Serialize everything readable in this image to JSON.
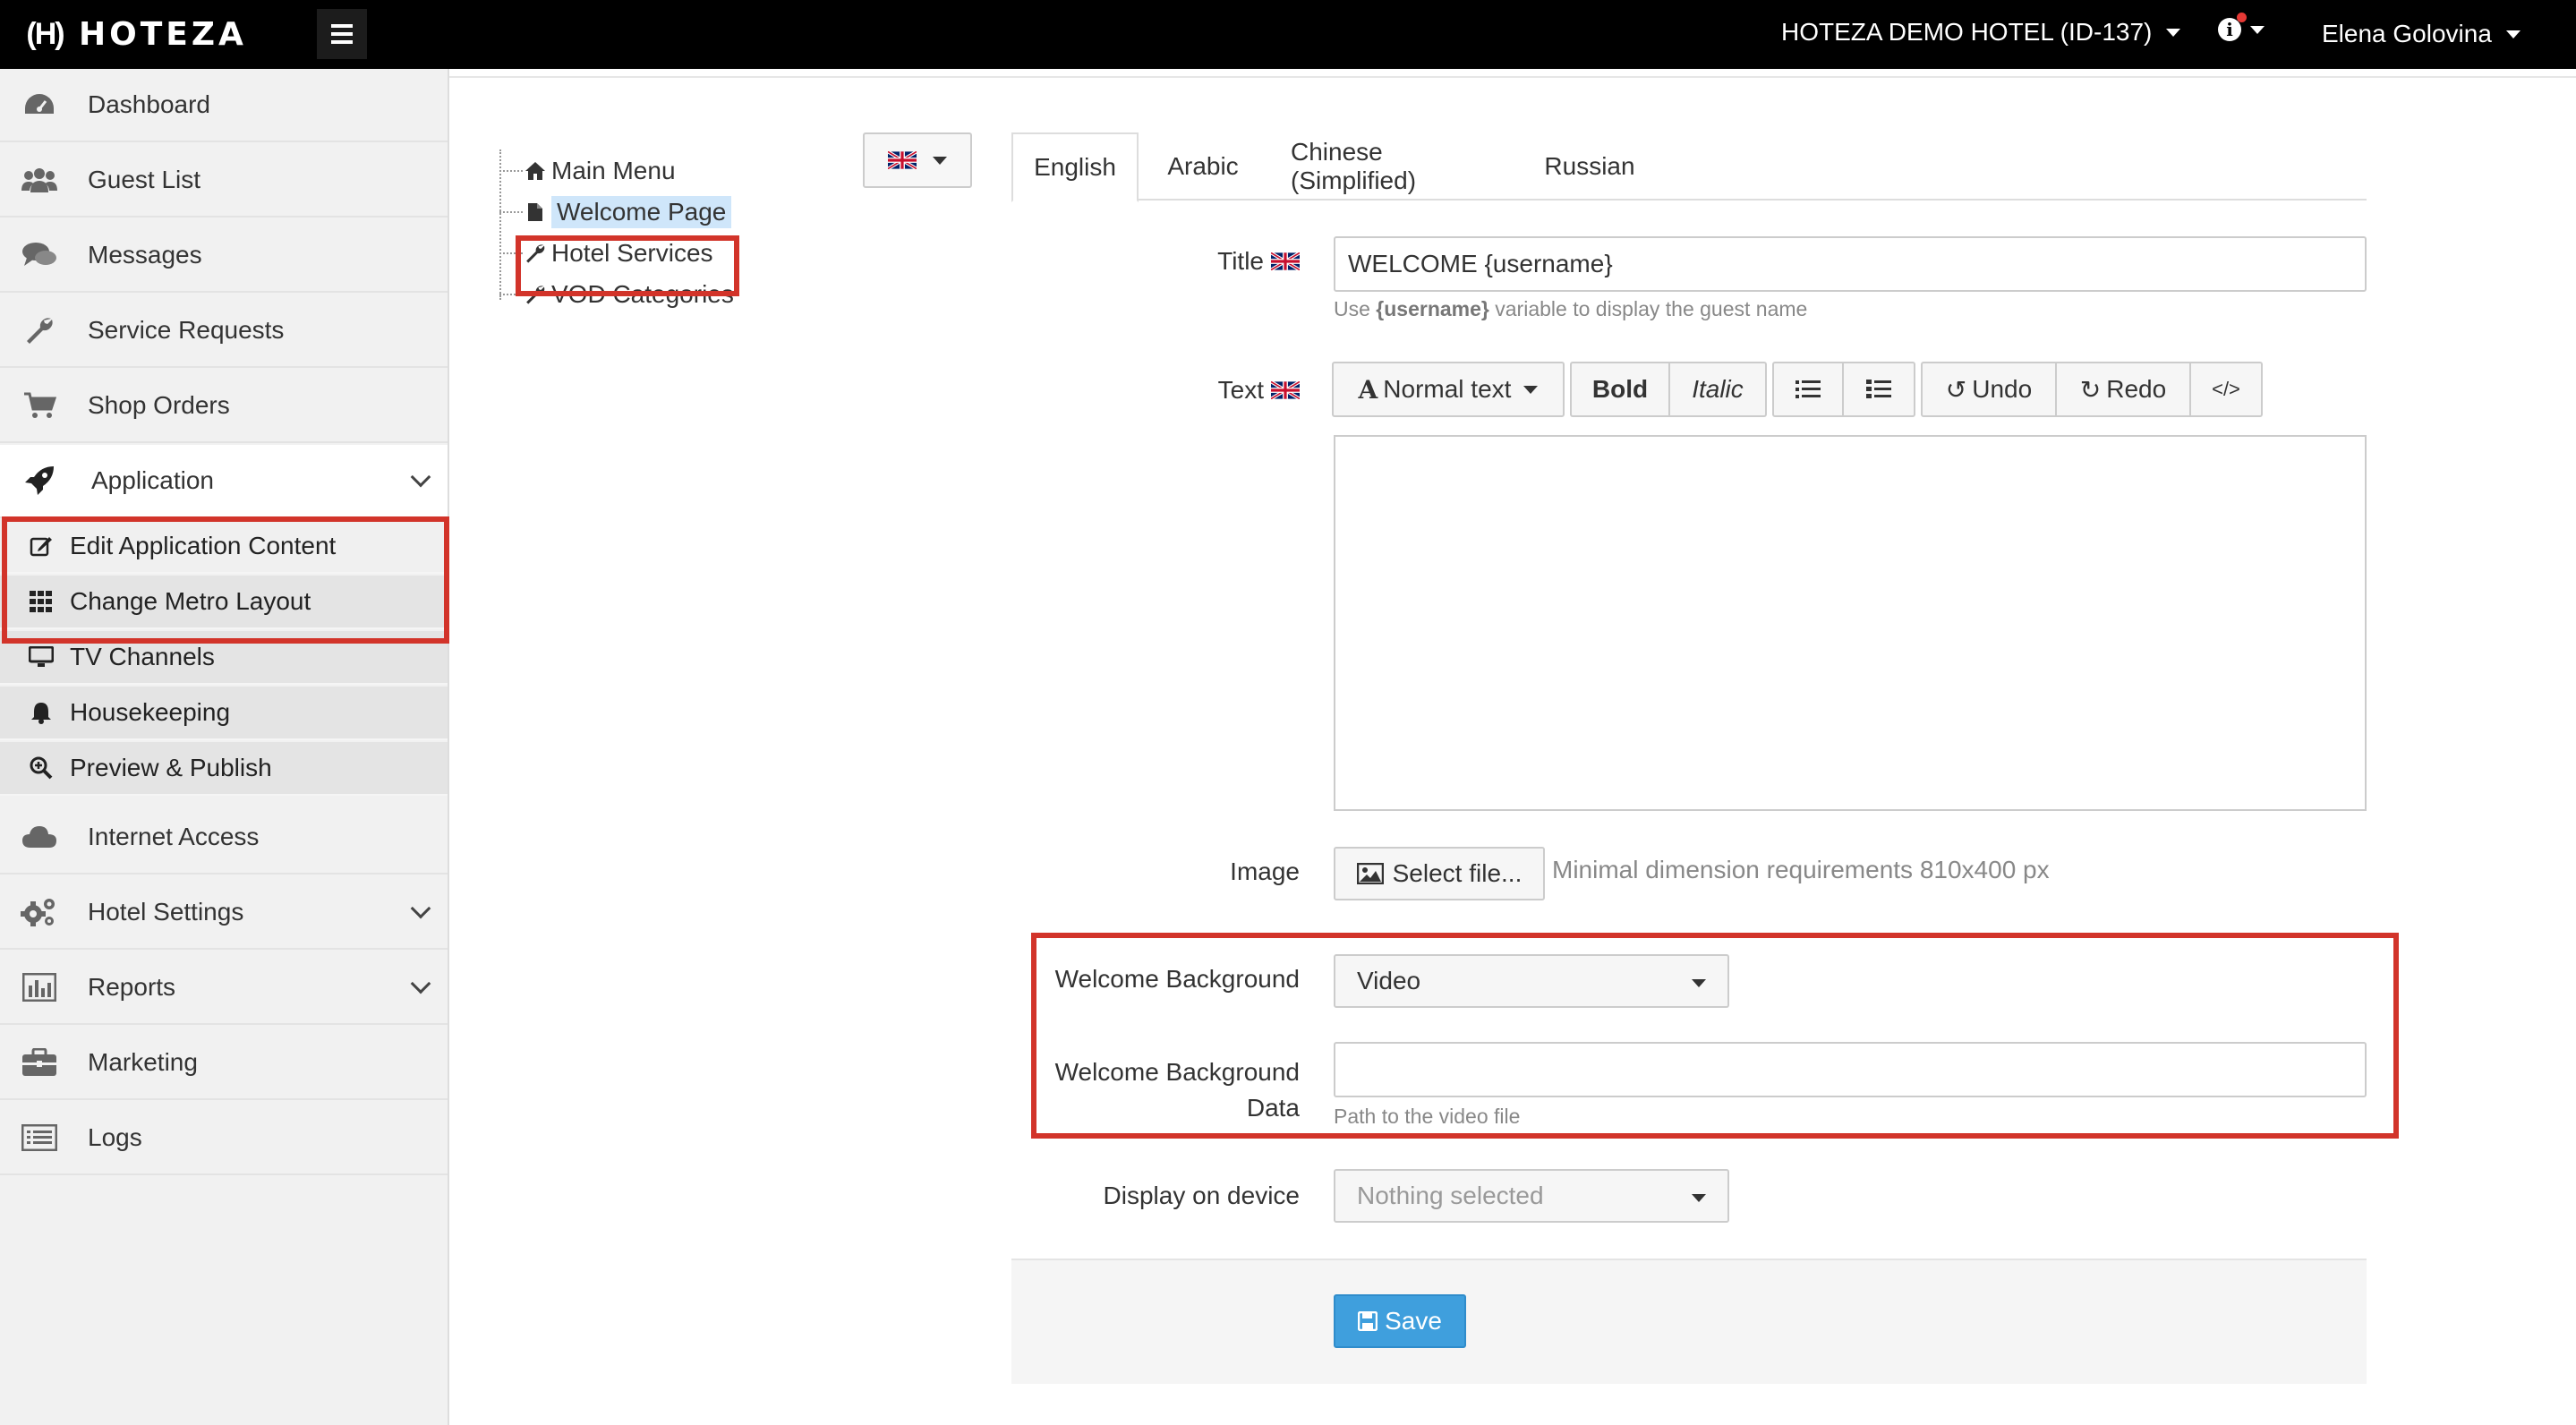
{
  "topbar": {
    "logo_text": "HOTEZA",
    "hotel_name": "HOTEZA DEMO HOTEL (ID-137)",
    "user_name": "Elena Golovina"
  },
  "sidebar": {
    "items": [
      {
        "label": "Dashboard",
        "icon": "dashboard-icon"
      },
      {
        "label": "Guest List",
        "icon": "users-icon"
      },
      {
        "label": "Messages",
        "icon": "comments-icon"
      },
      {
        "label": "Service Requests",
        "icon": "wrench-icon"
      },
      {
        "label": "Shop Orders",
        "icon": "cart-icon"
      },
      {
        "label": "Application",
        "icon": "rocket-icon"
      },
      {
        "label": "Internet Access",
        "icon": "cloud-icon"
      },
      {
        "label": "Hotel Settings",
        "icon": "gears-icon"
      },
      {
        "label": "Reports",
        "icon": "bar-chart-icon"
      },
      {
        "label": "Marketing",
        "icon": "briefcase-icon"
      },
      {
        "label": "Logs",
        "icon": "list-icon"
      }
    ],
    "sub_items": [
      {
        "label": "Edit Application Content",
        "icon": "edit-icon"
      },
      {
        "label": "Change Metro Layout",
        "icon": "grid-icon"
      },
      {
        "label": "TV Channels",
        "icon": "monitor-icon"
      },
      {
        "label": "Housekeeping",
        "icon": "bell-icon"
      },
      {
        "label": "Preview & Publish",
        "icon": "search-plus-icon"
      }
    ]
  },
  "tree": {
    "items": [
      {
        "label": "Main Menu",
        "icon": "home-icon"
      },
      {
        "label": "Welcome Page",
        "icon": "file-icon",
        "selected": true
      },
      {
        "label": "Hotel Services",
        "icon": "wrench-icon"
      },
      {
        "label": "VOD Categories",
        "icon": "wrench-icon"
      }
    ]
  },
  "tabs": [
    "English",
    "Arabic",
    "Chinese (Simplified)",
    "Russian"
  ],
  "active_tab": "English",
  "form": {
    "title_label": "Title",
    "title_value": "WELCOME {username}",
    "title_help_prefix": "Use ",
    "title_help_var": "{username}",
    "title_help_suffix": " variable to display the guest name",
    "text_label": "Text",
    "toolbar": {
      "normal_text": "Normal text",
      "bold": "Bold",
      "italic": "Italic",
      "undo": "Undo",
      "redo": "Redo",
      "code": "</>"
    },
    "image_label": "Image",
    "select_file": "Select file...",
    "image_help": "Minimal dimension requirements 810x400 px",
    "bg_label": "Welcome Background",
    "bg_value": "Video",
    "bg_data_label_1": "Welcome Background",
    "bg_data_label_2": "Data",
    "bg_data_value": "",
    "bg_data_help": "Path to the video file",
    "device_label": "Display on device",
    "device_value": "Nothing selected",
    "save": "Save"
  },
  "colors": {
    "highlight_border": "#d2342a",
    "save_button": "#3f9fdd",
    "topbar": "#000000"
  }
}
